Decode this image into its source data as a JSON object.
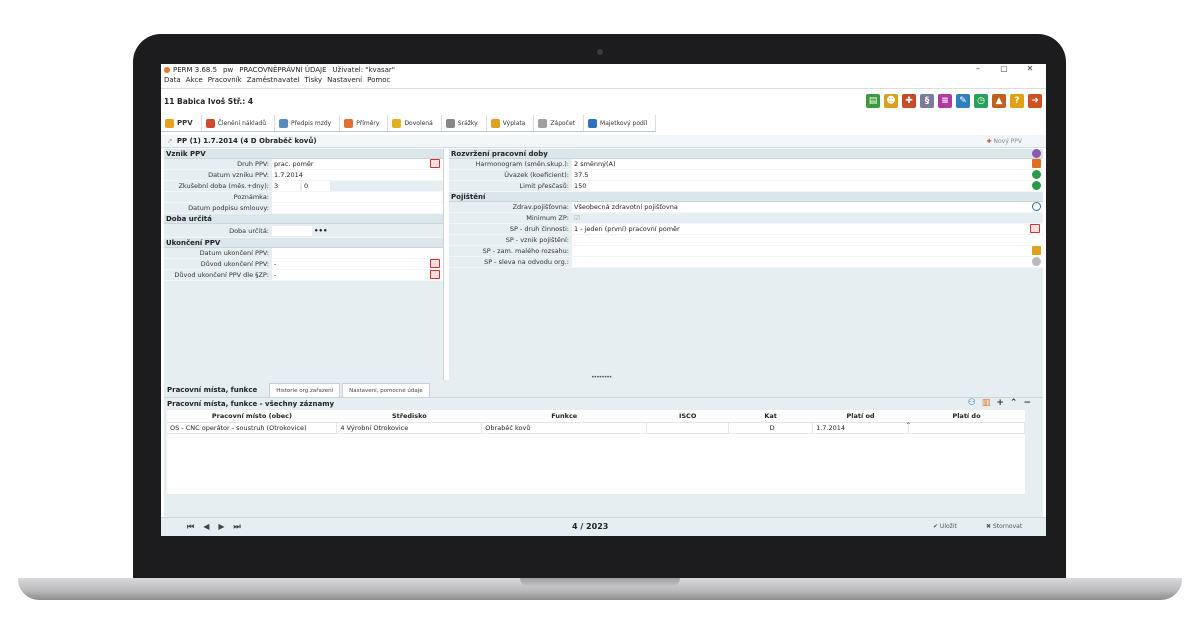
{
  "window": {
    "title": "PERM 3.68.5",
    "db": "pw",
    "module": "PRACOVNĚPRÁVNÍ ÚDAJE",
    "user": "Uživatel: \"kvasar\"",
    "min": "–",
    "max": "▢",
    "close": "✕"
  },
  "menu": [
    "Data",
    "Akce",
    "Pracovník",
    "Zaměstnavatel",
    "Tisky",
    "Nastavení",
    "Pomoc"
  ],
  "person": "11  Babica Ivoš Stř.: 4",
  "tabs": [
    "PPV",
    "Členění nákladů",
    "Předpis mzdy",
    "Příměry",
    "Dovolená",
    "Srážky",
    "Výplata",
    "Zápočet",
    "Majetkový podíl"
  ],
  "contract": {
    "title": "PP (1) 1.7.2014 (4 D Obraběč kovů)",
    "new_label": "Nový PPV"
  },
  "vznik": {
    "header": "Vznik PPV",
    "druh_lbl": "Druh PPV:",
    "druh": "prac. poměr",
    "datum_lbl": "Datum vzniku PPV:",
    "datum": "1.7.2014",
    "zkus_lbl": "Zkušební doba (měs.+dny):",
    "zkus_m": "3",
    "zkus_d": "0",
    "pozn_lbl": "Poznámka:",
    "pozn": "",
    "podpis_lbl": "Datum podpisu smlouvy:",
    "podpis": ""
  },
  "doba": {
    "header": "Doba určitá",
    "lbl": "Doba určitá:",
    "btn": "•••"
  },
  "ukonceni": {
    "header": "Ukončení PPV",
    "datum_lbl": "Datum ukončení PPV:",
    "datum": "",
    "duvod_lbl": "Důvod ukončení PPV:",
    "duvod": "-",
    "duvodzp_lbl": "Důvod ukončení PPV dle §ZP:",
    "duvodzp": "-"
  },
  "rozvrzeni": {
    "header": "Rozvržení pracovní doby",
    "harm_lbl": "Harmonogram (směn.skup.):",
    "harm": "2 směnný(A)",
    "uvazek_lbl": "Úvazek (koeficient):",
    "uvazek": "37.5",
    "limit_lbl": "Limit přesčasů:",
    "limit": "150"
  },
  "pojisteni": {
    "header": "Pojištění",
    "zdrav_lbl": "Zdrav.pojišťovna:",
    "zdrav": "Všeobecná zdravotní pojišťovna",
    "minzp_lbl": "Minimum ZP:",
    "minzp": "☑",
    "spdruh_lbl": "SP - druh činnosti:",
    "spdruh": "1 - jeden (první) pracovní poměr",
    "spvznik_lbl": "SP - vznik pojištění:",
    "spvznik": "",
    "spmaly_lbl": "SP - zam. malého rozsahu:",
    "spmaly": "",
    "spsleva_lbl": "SP - sleva na odvodu org.:",
    "spsleva": ""
  },
  "lower": {
    "title": "Pracovní místa, funkce",
    "tabs": [
      "Historie org.zařazení",
      "Nastavení, pomocné údaje"
    ],
    "subtitle": "Pracovní místa, funkce - všechny záznamy",
    "columns": [
      "Pracovní místo (obec)",
      "Středisko",
      "Funkce",
      "ISCO",
      "Kat",
      "Platí od",
      "Platí do"
    ],
    "rows": [
      [
        "OS - CNC operátor - soustruh (Otrokovice)",
        "4 Výrobní Otrokovice",
        "Obraběč kovů",
        "",
        "D",
        "1.7.2014",
        ""
      ]
    ]
  },
  "status": {
    "nav": [
      "⏮",
      "◀",
      "▶",
      "⏭"
    ],
    "period": "4 / 2023",
    "save": "✔ Uložit",
    "cancel": "✖ Stornovat"
  },
  "colors": {
    "accent": "#2a6db0",
    "panel": "#e6eef1",
    "section": "#dbe6eb"
  }
}
